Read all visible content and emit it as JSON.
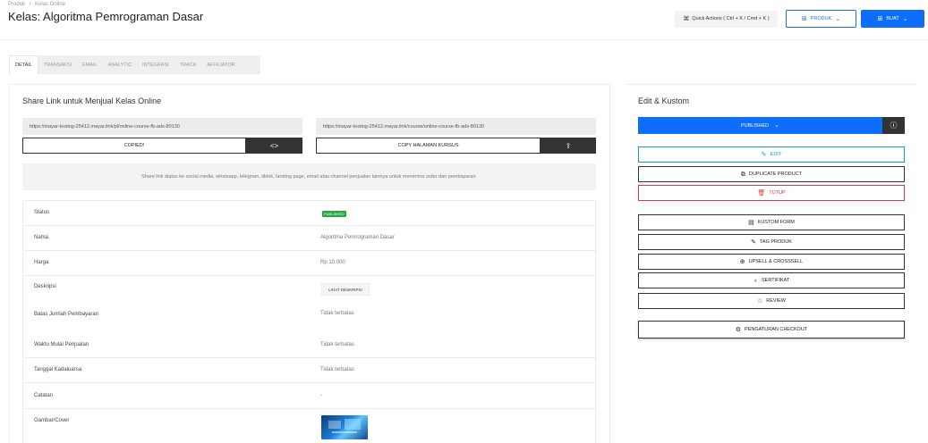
{
  "breadcrumb": [
    "Produk",
    "Kelas Online"
  ],
  "page_title": "Kelas: Algoritma Pemrograman Dasar",
  "header": {
    "quick_actions_label": "Quick Actions ( Ctrl + K / Cmd + K )",
    "produk_label": "PRODUK",
    "buat_label": "BUAT"
  },
  "tabs": [
    "DETAIL",
    "TRANSAKSI",
    "EMAIL",
    "ANALYTIC",
    "INTEGRASI",
    "TRACK",
    "AFFILIATOR"
  ],
  "share": {
    "title": "Share Link untuk Menjual Kelas Online",
    "link1": "https://mayar-testing-25412.mayar.link/pl/online-course-fb-ads-80130",
    "link2": "https://mayar-testing-25412.mayar.link/course/online-course-fb-ads-80130",
    "copied_label": "COPIED!",
    "copy_page_label": "COPY HALAMAN KURSUS",
    "note": "Share link diatas ke social media, whatsapp, telegram, tiktok, landing page, email atau channel penjualan lainnya untuk menerima order dan pembayaran."
  },
  "details": {
    "status_label": "Status",
    "status_value": "PUBLISHED",
    "nama_label": "Nama",
    "nama_value": "Algoritma Pemrograman Dasar",
    "harga_label": "Harga",
    "harga_value": "Rp 10.000",
    "deskripsi_label": "Deskripsi",
    "deskripsi_button": "LIHAT DESKRIPSI",
    "batas_label": "Batas Jumlah Pembayaran",
    "batas_value": "Tidak terbatas",
    "waktu_label": "Waktu Mulai Penjualan",
    "waktu_value": "Tidak terbatas",
    "tanggal_label": "Tanggal Kadaluarsa",
    "tanggal_value": "Tidak terbatas",
    "catatan_label": "Catatan",
    "catatan_value": "-",
    "gambar_label": "Gambar/Cover"
  },
  "edit_panel": {
    "title": "Edit & Kustom",
    "published_label": "PUBLISHED",
    "edit_label": "EDIT",
    "duplicate_label": "DUPLICATE PRODUCT",
    "tutup_label": "TUTUP",
    "kustom_form_label": "KUSTOM FORM",
    "tag_produk_label": "TAG PRODUK",
    "upsell_label": "UPSELL & CROSSSELL",
    "sertifikat_label": "SERTIFIKAT",
    "review_label": "REVIEW",
    "checkout_label": "PENGATURAN CHECKOUT"
  },
  "colors": {
    "primary": "#0d6efd",
    "dark": "#333333",
    "success": "#28a745",
    "danger": "#dc3545",
    "info": "#17a2b8"
  }
}
